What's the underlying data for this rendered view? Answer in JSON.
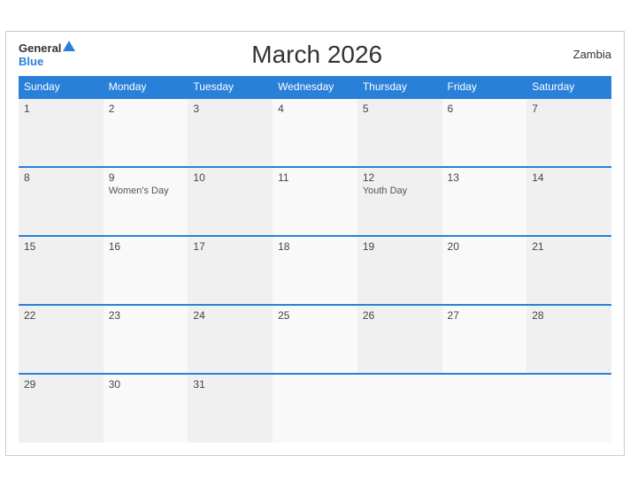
{
  "header": {
    "title": "March 2026",
    "country": "Zambia",
    "logo_general": "General",
    "logo_blue": "Blue"
  },
  "weekdays": [
    "Sunday",
    "Monday",
    "Tuesday",
    "Wednesday",
    "Thursday",
    "Friday",
    "Saturday"
  ],
  "weeks": [
    [
      {
        "day": "1",
        "event": ""
      },
      {
        "day": "2",
        "event": ""
      },
      {
        "day": "3",
        "event": ""
      },
      {
        "day": "4",
        "event": ""
      },
      {
        "day": "5",
        "event": ""
      },
      {
        "day": "6",
        "event": ""
      },
      {
        "day": "7",
        "event": ""
      }
    ],
    [
      {
        "day": "8",
        "event": ""
      },
      {
        "day": "9",
        "event": "Women's Day"
      },
      {
        "day": "10",
        "event": ""
      },
      {
        "day": "11",
        "event": ""
      },
      {
        "day": "12",
        "event": "Youth Day"
      },
      {
        "day": "13",
        "event": ""
      },
      {
        "day": "14",
        "event": ""
      }
    ],
    [
      {
        "day": "15",
        "event": ""
      },
      {
        "day": "16",
        "event": ""
      },
      {
        "day": "17",
        "event": ""
      },
      {
        "day": "18",
        "event": ""
      },
      {
        "day": "19",
        "event": ""
      },
      {
        "day": "20",
        "event": ""
      },
      {
        "day": "21",
        "event": ""
      }
    ],
    [
      {
        "day": "22",
        "event": ""
      },
      {
        "day": "23",
        "event": ""
      },
      {
        "day": "24",
        "event": ""
      },
      {
        "day": "25",
        "event": ""
      },
      {
        "day": "26",
        "event": ""
      },
      {
        "day": "27",
        "event": ""
      },
      {
        "day": "28",
        "event": ""
      }
    ],
    [
      {
        "day": "29",
        "event": ""
      },
      {
        "day": "30",
        "event": ""
      },
      {
        "day": "31",
        "event": ""
      },
      {
        "day": "",
        "event": ""
      },
      {
        "day": "",
        "event": ""
      },
      {
        "day": "",
        "event": ""
      },
      {
        "day": "",
        "event": ""
      }
    ]
  ]
}
